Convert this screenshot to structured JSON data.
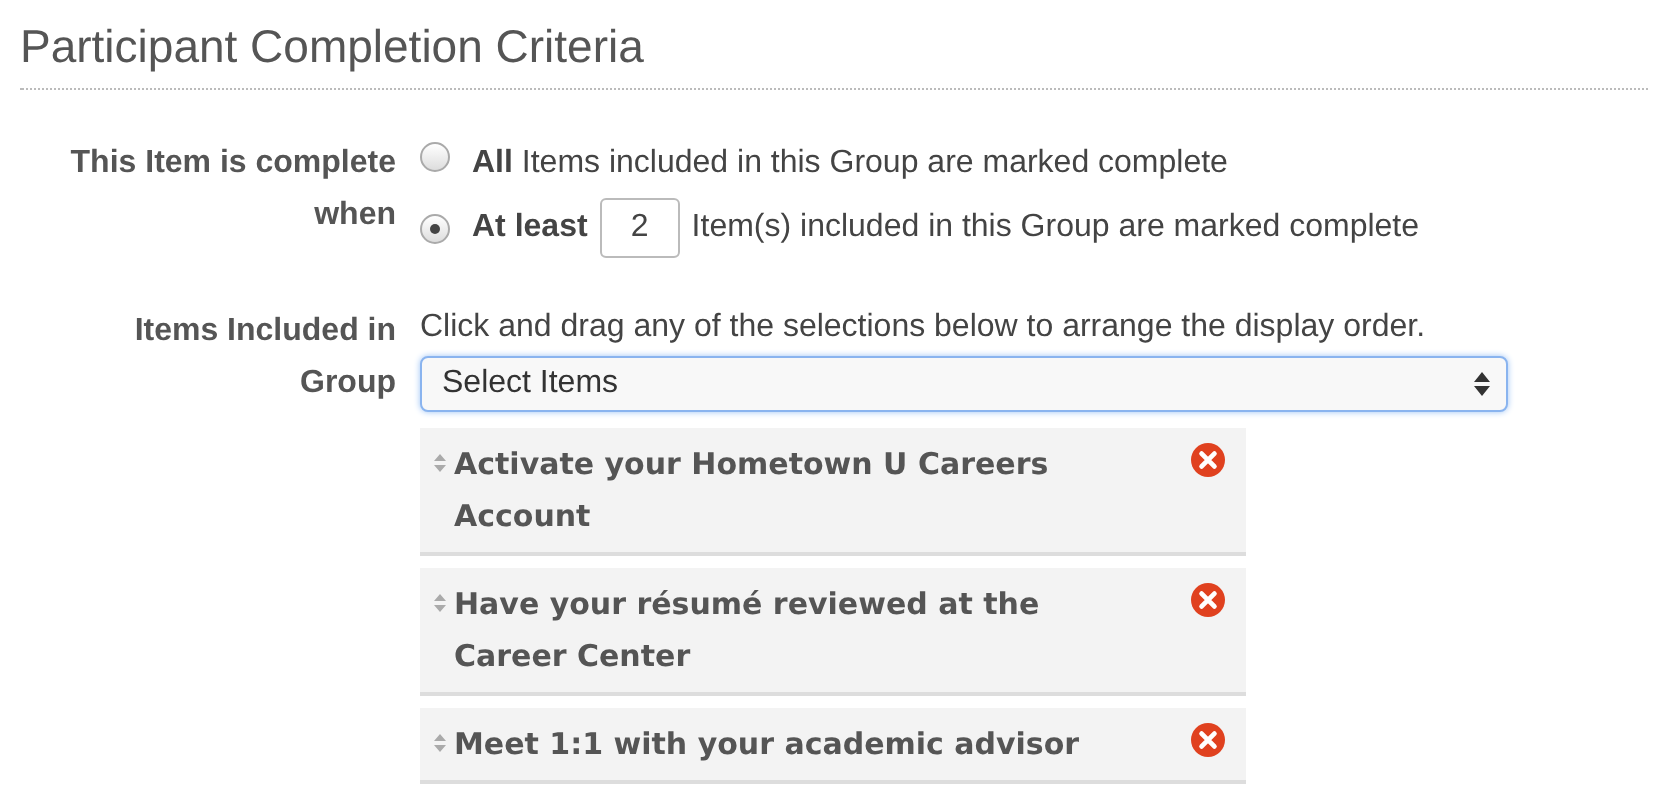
{
  "heading": "Participant Completion Criteria",
  "completion": {
    "label": "This Item is complete when",
    "options": [
      {
        "kind": "all",
        "label": "All",
        "text": "Items included in this Group are marked complete",
        "selected": false
      },
      {
        "kind": "at_least",
        "label": "At least",
        "count": "2",
        "text": "Item(s) included in this Group are marked complete",
        "selected": true
      }
    ]
  },
  "items_group": {
    "label": "Items Included in Group",
    "hint": "Click and drag any of the selections below to arrange the display order.",
    "select": {
      "value": "Select Items"
    },
    "items": [
      {
        "title": "Activate your Hometown U Careers Account"
      },
      {
        "title": "Have your résumé reviewed at the Career Center"
      },
      {
        "title": "Meet 1:1 with your academic advisor"
      }
    ]
  }
}
